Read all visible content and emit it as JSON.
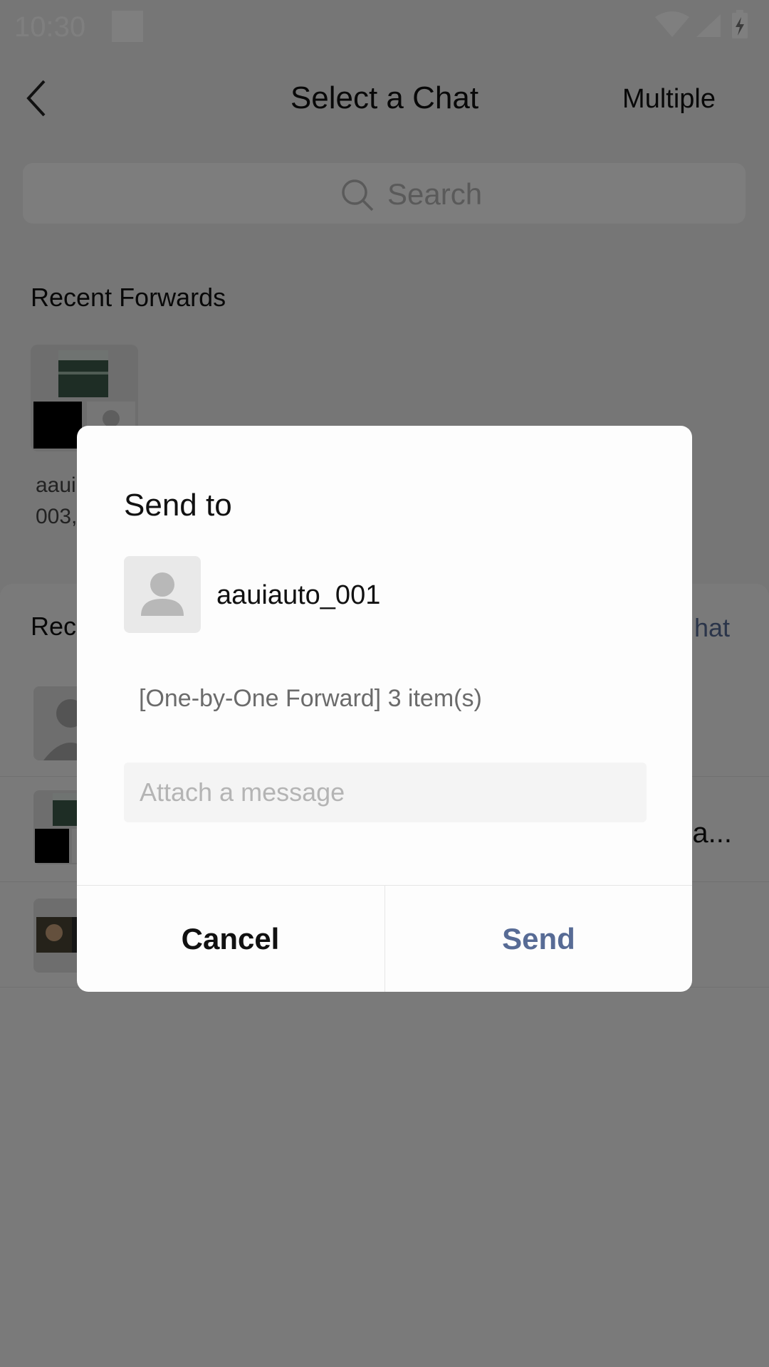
{
  "status_bar": {
    "time": "10:30"
  },
  "header": {
    "title": "Select a Chat",
    "multiple_label": "Multiple"
  },
  "search": {
    "placeholder": "Search"
  },
  "recent_forwards": {
    "title": "Recent Forwards",
    "items": [
      {
        "name_line1": "aaui",
        "name_line2": "003,"
      }
    ]
  },
  "recent_chats": {
    "title": "Rece",
    "new_chat_label": "hat",
    "rows": [
      {
        "trail": ""
      },
      {
        "trail": "a..."
      },
      {
        "trail": ""
      }
    ]
  },
  "dialog": {
    "title": "Send to",
    "recipient_name": "aauiauto_001",
    "forward_summary": "[One-by-One Forward] 3 item(s)",
    "message_placeholder": "Attach a message",
    "cancel_label": "Cancel",
    "send_label": "Send"
  },
  "colors": {
    "accent": "#576b95",
    "overlay": "rgba(0,0,0,0.5)"
  }
}
